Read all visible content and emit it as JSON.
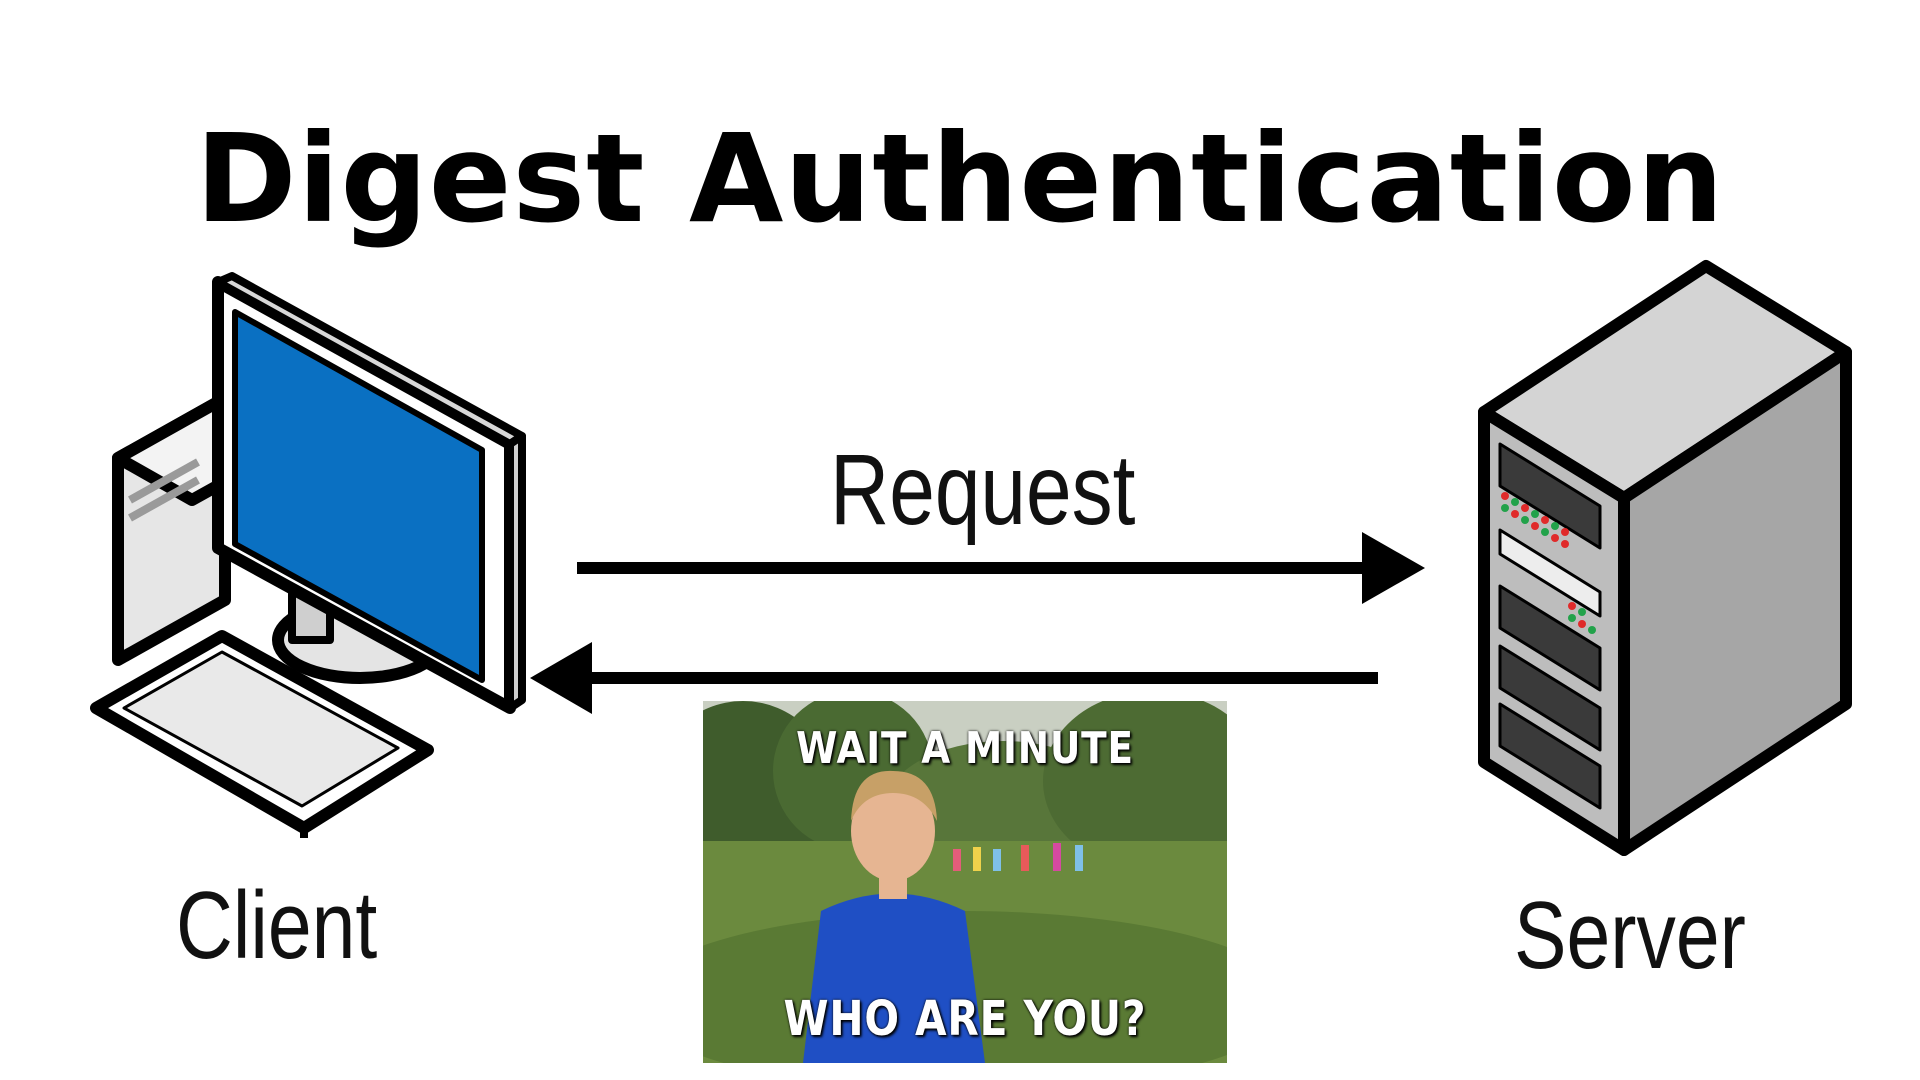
{
  "title": "Digest Authentication",
  "labels": {
    "request": "Request",
    "client": "Client",
    "server": "Server"
  },
  "meme": {
    "top_caption": "WAIT A MINUTE",
    "bottom_caption": "WHO ARE YOU?"
  },
  "colors": {
    "screen": "#0a70c2",
    "server_front": "#bdbdbd",
    "server_side": "#a3a3a3",
    "led_red": "#e02a2a",
    "led_green": "#22a24a"
  },
  "icons": {
    "client": "desktop-computer-icon",
    "server": "server-tower-icon",
    "arrow_request": "arrow-right",
    "arrow_response": "arrow-left"
  }
}
